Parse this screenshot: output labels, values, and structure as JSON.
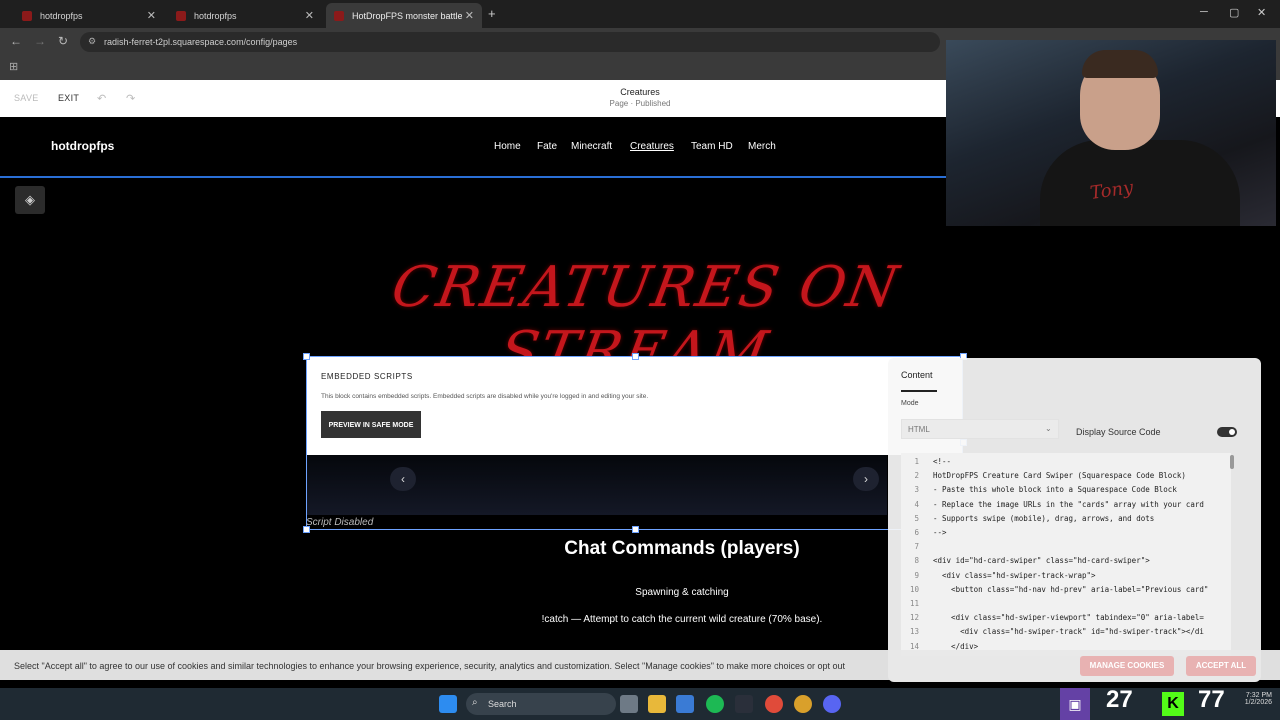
{
  "browser": {
    "tabs": [
      {
        "label": "hotdropfps",
        "active": false
      },
      {
        "label": "hotdropfps",
        "active": false
      },
      {
        "label": "HotDropFPS monster battle sty",
        "active": true
      }
    ],
    "new_tab": "+",
    "url": "radish-ferret-t2pl.squarespace.com/config/pages"
  },
  "editor": {
    "save_label": "SAVE",
    "exit_label": "EXIT",
    "page_title": "Creatures",
    "page_status": "Page · Published"
  },
  "site": {
    "brand": "hotdropfps",
    "nav": [
      "Home",
      "Fate",
      "Minecraft",
      "Creatures",
      "Team HD",
      "Merch"
    ],
    "active_nav": "Creatures",
    "hero_title": "CREATURES ON STREAM"
  },
  "embed": {
    "heading": "EMBEDDED SCRIPTS",
    "message": "This block contains embedded scripts. Embedded scripts are disabled while you're logged in and editing your site.",
    "safe_mode_button": "PREVIEW IN SAFE MODE",
    "prev": "‹",
    "next": "›",
    "script_disabled": "Script Disabled"
  },
  "page_body": {
    "chat_heading": "Chat Commands (players)",
    "spawning": "Spawning & catching",
    "catch_line": "!catch — Attempt to catch the current wild creature (70% base)."
  },
  "panel": {
    "tab": "Content",
    "mode_label": "Mode",
    "mode_value": "HTML",
    "display_source": "Display Source Code",
    "code_lines": [
      {
        "n": "1",
        "t": "<!--"
      },
      {
        "n": "2",
        "t": "HotDropFPS Creature Card Swiper (Squarespace Code Block)"
      },
      {
        "n": "3",
        "t": "- Paste this whole block into a Squarespace Code Block"
      },
      {
        "n": "4",
        "t": "- Replace the image URLs in the \"cards\" array with your card"
      },
      {
        "n": "5",
        "t": "- Supports swipe (mobile), drag, arrows, and dots"
      },
      {
        "n": "6",
        "t": "-->"
      },
      {
        "n": "7",
        "t": ""
      },
      {
        "n": "8",
        "t": "<div id=\"hd-card-swiper\" class=\"hd-card-swiper\">"
      },
      {
        "n": "9",
        "t": "  <div class=\"hd-swiper-track-wrap\">"
      },
      {
        "n": "10",
        "t": "    <button class=\"hd-nav hd-prev\" aria-label=\"Previous card\""
      },
      {
        "n": "11",
        "t": ""
      },
      {
        "n": "12",
        "t": "    <div class=\"hd-swiper-viewport\" tabindex=\"0\" aria-label="
      },
      {
        "n": "13",
        "t": "      <div class=\"hd-swiper-track\" id=\"hd-swiper-track\"></di"
      },
      {
        "n": "14",
        "t": "    </div>"
      }
    ]
  },
  "cookies": {
    "text": "Select \"Accept all\" to agree to our use of cookies and similar technologies to enhance your browsing experience, security, analytics and customization. Select \"Manage cookies\" to make more choices or opt out",
    "manage": "MANAGE COOKIES",
    "accept": "ACCEPT ALL"
  },
  "taskbar": {
    "search": "Search",
    "twitch_count": "27",
    "kick_count": "77",
    "time": "7:32 PM",
    "date": "1/2/2026"
  },
  "webcam": {
    "shirt_text": "Tony"
  },
  "colors": {
    "accent_blue": "#2a6fd6",
    "hero_red": "#c4161c",
    "twitch": "#6441a5",
    "kick": "#53fc18"
  }
}
